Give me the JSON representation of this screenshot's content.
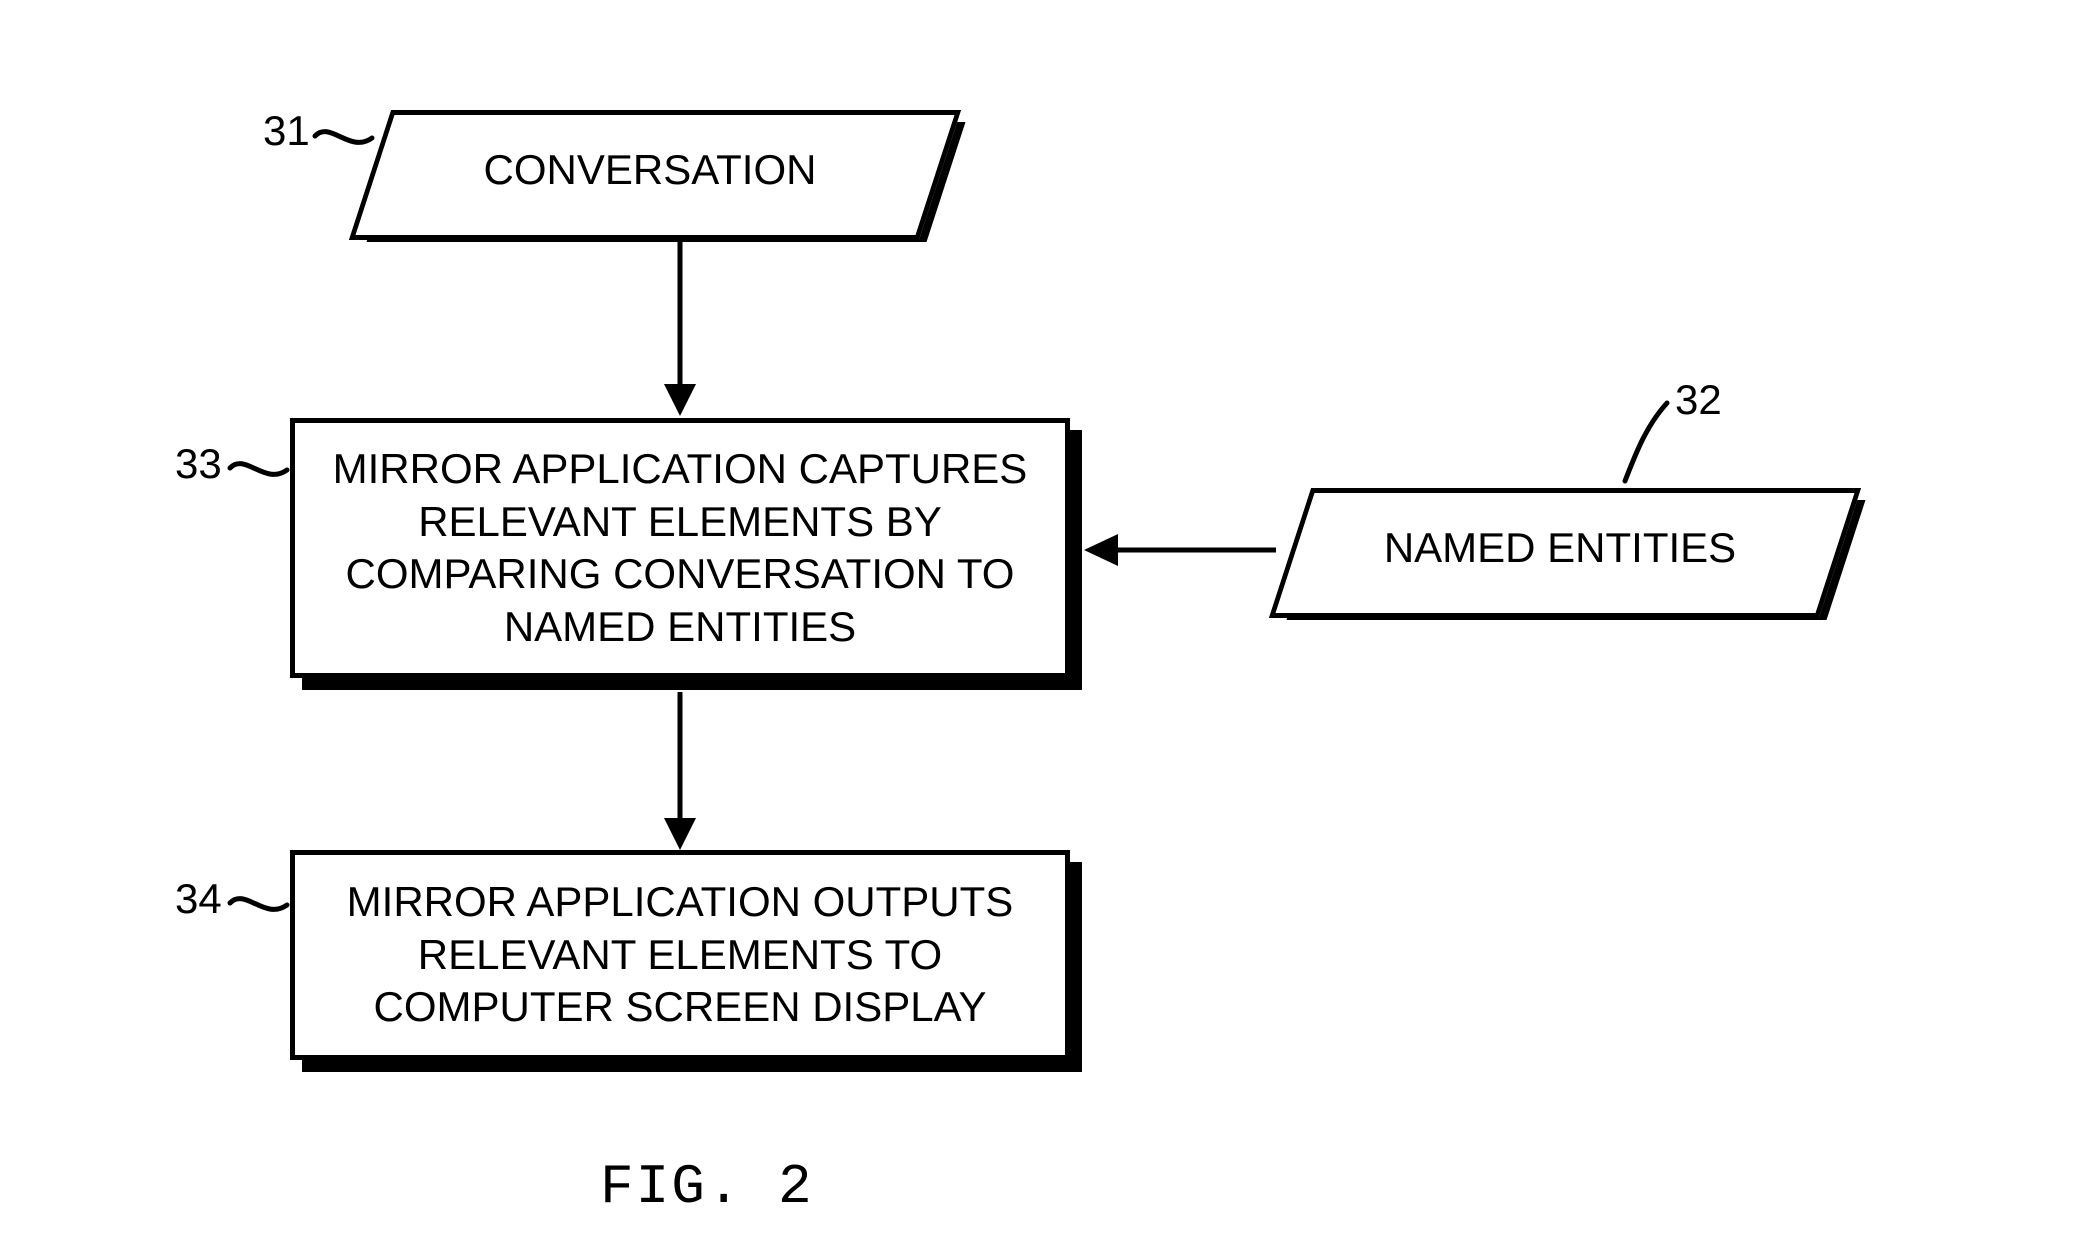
{
  "nodes": {
    "n31": {
      "ref": "31",
      "text": "CONVERSATION"
    },
    "n32": {
      "ref": "32",
      "text": "NAMED ENTITIES"
    },
    "n33": {
      "ref": "33",
      "text": "MIRROR APPLICATION CAPTURES RELEVANT ELEMENTS BY COMPARING CONVERSATION TO NAMED ENTITIES"
    },
    "n34": {
      "ref": "34",
      "text": "MIRROR APPLICATION OUTPUTS RELEVANT ELEMENTS TO COMPUTER SCREEN DISPLAY"
    }
  },
  "caption": "FIG. 2"
}
